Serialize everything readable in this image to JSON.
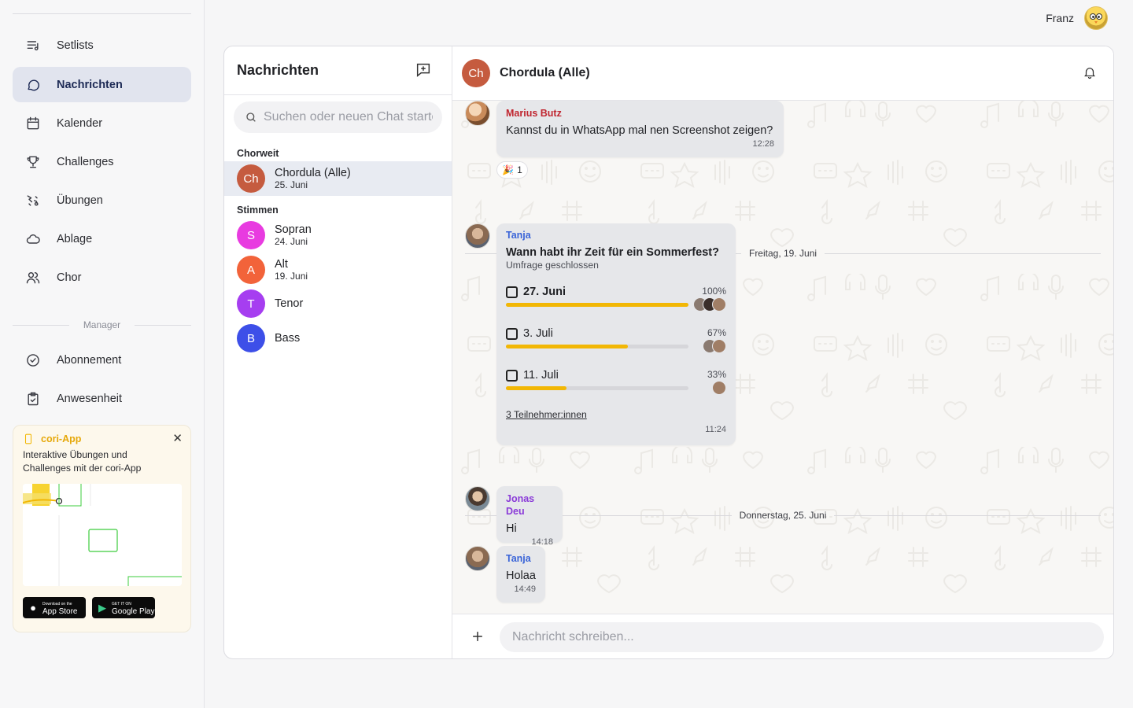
{
  "sidebar": {
    "nav": [
      {
        "label": "Setlists",
        "icon": "setlist-icon"
      },
      {
        "label": "Nachrichten",
        "icon": "chat-bubble-icon",
        "active": true
      },
      {
        "label": "Kalender",
        "icon": "calendar-icon"
      },
      {
        "label": "Challenges",
        "icon": "trophy-icon"
      },
      {
        "label": "Übungen",
        "icon": "exercise-icon"
      },
      {
        "label": "Ablage",
        "icon": "cloud-icon"
      },
      {
        "label": "Chor",
        "icon": "users-icon"
      }
    ],
    "section_label": "Manager",
    "manager_nav": [
      {
        "label": "Abonnement",
        "icon": "check-circle-icon"
      },
      {
        "label": "Anwesenheit",
        "icon": "clipboard-check-icon"
      }
    ],
    "promo": {
      "title": "cori-App",
      "text": "Interaktive Übungen und Challenges mit der cori-App",
      "app_store": {
        "small": "Download on the",
        "big": "App Store"
      },
      "google_play": {
        "small": "GET IT ON",
        "big": "Google Play"
      }
    }
  },
  "user": {
    "name": "Franz"
  },
  "chatlist": {
    "title": "Nachrichten",
    "search_placeholder": "Suchen oder neuen Chat starten",
    "groups": [
      {
        "label": "Chorweit",
        "chats": [
          {
            "initials": "Ch",
            "name": "Chordula (Alle)",
            "date": "25. Juni",
            "color": "#c55b3f",
            "active": true
          }
        ]
      },
      {
        "label": "Stimmen",
        "chats": [
          {
            "initials": "S",
            "name": "Sopran",
            "date": "24. Juni",
            "color": "#e83be0"
          },
          {
            "initials": "A",
            "name": "Alt",
            "date": "19. Juni",
            "color": "#f2633a"
          },
          {
            "initials": "T",
            "name": "Tenor",
            "date": "",
            "color": "#a63ef0"
          },
          {
            "initials": "B",
            "name": "Bass",
            "date": "",
            "color": "#3d4fe8"
          }
        ]
      }
    ]
  },
  "conversation": {
    "initials": "Ch",
    "title": "Chordula (Alle)",
    "composer_placeholder": "Nachricht schreiben...",
    "messages": [
      {
        "sender": "Marius Butz",
        "sender_color": "#c0252f",
        "text": "Kannst du in WhatsApp mal nen Screenshot zeigen?",
        "time": "12:28",
        "reaction": {
          "emoji": "🎉",
          "count": "1"
        }
      },
      {
        "sender": "Tanja",
        "sender_color": "#3a64d8",
        "time": "11:24"
      },
      {
        "sender": "Jonas Deu",
        "sender_color": "#8a3ad8",
        "text": "Hi",
        "time": "14:18"
      },
      {
        "sender": "Tanja",
        "sender_color": "#3a64d8",
        "text": "Holaa",
        "time": "14:49"
      }
    ],
    "date_separators": [
      "Freitag, 19. Juni",
      "Donnerstag, 25. Juni"
    ],
    "poll": {
      "question": "Wann habt ihr Zeit für ein Sommerfest?",
      "status": "Umfrage geschlossen",
      "options": [
        {
          "label": "27. Juni",
          "percent": "100%",
          "fraction": 1.0,
          "voters": 3,
          "bold": true
        },
        {
          "label": "3. Juli",
          "percent": "67%",
          "fraction": 0.67,
          "voters": 2,
          "bold": false
        },
        {
          "label": "11. Juli",
          "percent": "33%",
          "fraction": 0.33,
          "voters": 1,
          "bold": false
        }
      ],
      "participants": "3 Teilnehmer:innen"
    }
  },
  "colors": {
    "accent": "#f2b705",
    "active_nav_bg": "#e1e4ee",
    "active_nav_text": "#1d2a55"
  }
}
